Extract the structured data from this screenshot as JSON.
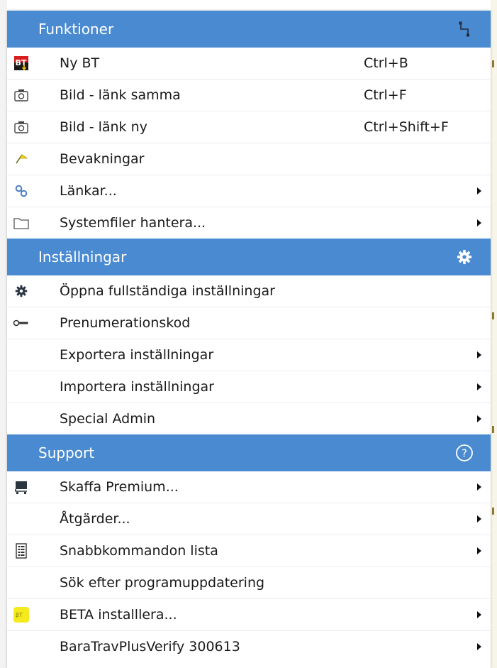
{
  "sections": [
    {
      "title": "Funktioner",
      "icon": "connector-icon",
      "items": [
        {
          "label": "Ny BT",
          "shortcut": "Ctrl+B",
          "icon": "bt-logo-icon",
          "submenu": false
        },
        {
          "label": "Bild - länk samma",
          "shortcut": "Ctrl+F",
          "icon": "camera-icon",
          "submenu": false
        },
        {
          "label": "Bild - länk ny",
          "shortcut": "Ctrl+Shift+F",
          "icon": "camera-icon",
          "submenu": false
        },
        {
          "label": "Bevakningar",
          "shortcut": "",
          "icon": "flag-icon",
          "submenu": false
        },
        {
          "label": "Länkar...",
          "shortcut": "",
          "icon": "link-icon",
          "submenu": true
        },
        {
          "label": "Systemfiler hantera...",
          "shortcut": "",
          "icon": "folder-icon",
          "submenu": true
        }
      ]
    },
    {
      "title": "Inställningar",
      "icon": "gear-icon",
      "items": [
        {
          "label": "Öppna fullständiga inställningar",
          "shortcut": "",
          "icon": "gear-icon",
          "submenu": false
        },
        {
          "label": "Prenumerationskod",
          "shortcut": "",
          "icon": "key-icon",
          "submenu": false
        },
        {
          "label": "Exportera inställningar",
          "shortcut": "",
          "icon": "",
          "submenu": true
        },
        {
          "label": "Importera inställningar",
          "shortcut": "",
          "icon": "",
          "submenu": true
        },
        {
          "label": "Special Admin",
          "shortcut": "",
          "icon": "",
          "submenu": true
        }
      ]
    },
    {
      "title": "Support",
      "icon": "help-circle-icon",
      "items": [
        {
          "label": "Skaffa Premium...",
          "shortcut": "",
          "icon": "cart-icon",
          "submenu": true
        },
        {
          "label": "Åtgärder...",
          "shortcut": "",
          "icon": "",
          "submenu": true
        },
        {
          "label": "Snabbkommandon lista",
          "shortcut": "",
          "icon": "list-icon",
          "submenu": true
        },
        {
          "label": "Sök efter programuppdatering",
          "shortcut": "",
          "icon": "",
          "submenu": false
        },
        {
          "label": "BETA installlera...",
          "shortcut": "",
          "icon": "beta-icon",
          "submenu": true
        },
        {
          "label": "BaraTravPlusVerify 300613",
          "shortcut": "",
          "icon": "",
          "submenu": true
        }
      ]
    }
  ],
  "colors": {
    "header_bg": "#4a8ad0",
    "header_text": "#ffffff",
    "item_text": "#1a1a1a",
    "divider": "#ececec"
  }
}
